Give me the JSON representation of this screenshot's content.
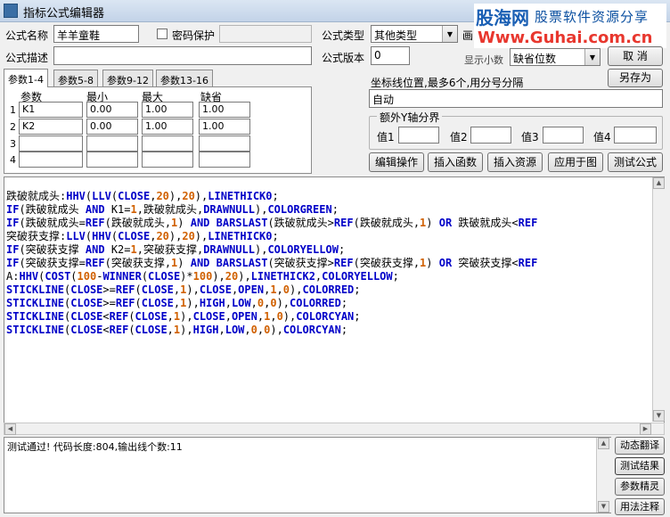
{
  "window": {
    "title": "指标公式编辑器"
  },
  "watermark": {
    "brand": "股海网",
    "tagline": "股票软件资源分享",
    "url": "Www.Guhai.com.cn"
  },
  "form": {
    "name_label": "公式名称",
    "name_value": "羊羊童鞋",
    "password_label": "密码保护",
    "password_checked": false,
    "type_label": "公式类型",
    "type_value": "其他类型",
    "draw_label": "画",
    "desc_label": "公式描述",
    "desc_value": "",
    "version_label": "公式版本",
    "version_value": "0",
    "decimal_label": "显示小数",
    "decimal_value": "缺省位数"
  },
  "buttons": {
    "cancel": "取 消",
    "save_as": "另存为",
    "edit_op": "编辑操作",
    "insert_func": "插入函数",
    "insert_res": "插入资源",
    "apply_chart": "应用于图",
    "test_formula": "测试公式",
    "dyn_translate": "动态翻译",
    "test_result": "测试结果",
    "param_tips": "参数精灵",
    "usage_notes": "用法注释"
  },
  "tabs": [
    "参数1-4",
    "参数5-8",
    "参数9-12",
    "参数13-16"
  ],
  "params": {
    "headers": [
      "参数",
      "最小",
      "最大",
      "缺省"
    ],
    "rows": [
      {
        "num": "1",
        "name": "K1",
        "min": "0.00",
        "max": "1.00",
        "default": "1.00"
      },
      {
        "num": "2",
        "name": "K2",
        "min": "0.00",
        "max": "1.00",
        "default": "1.00"
      },
      {
        "num": "3",
        "name": "",
        "min": "",
        "max": "",
        "default": ""
      },
      {
        "num": "4",
        "name": "",
        "min": "",
        "max": "",
        "default": ""
      }
    ]
  },
  "axis": {
    "label": "坐标线位置,最多6个,用分号分隔",
    "value": "自动",
    "extra_title": "额外Y轴分界",
    "extra_labels": [
      "值1",
      "值2",
      "值3",
      "值4"
    ],
    "extra_values": [
      "",
      "",
      "",
      ""
    ]
  },
  "code_lines": [
    "跌破就成头:HHV(LLV(CLOSE,20),20),LINETHICK0;",
    "IF(跌破就成头 AND K1=1,跌破就成头,DRAWNULL),COLORGREEN;",
    "IF(跌破就成头=REF(跌破就成头,1) AND BARSLAST(跌破就成头>REF(跌破就成头,1) OR 跌破就成头<REF",
    "突破获支撑:LLV(HHV(CLOSE,20),20),LINETHICK0;",
    "IF(突破获支撑 AND K2=1,突破获支撑,DRAWNULL),COLORYELLOW;",
    "IF(突破获支撑=REF(突破获支撑,1) AND BARSLAST(突破获支撑>REF(突破获支撑,1) OR 突破获支撑<REF",
    "A:HHV(COST(100-WINNER(CLOSE)*100),20),LINETHICK2,COLORYELLOW;",
    "STICKLINE(CLOSE>=REF(CLOSE,1),CLOSE,OPEN,1,0),COLORRED;",
    "STICKLINE(CLOSE>=REF(CLOSE,1),HIGH,LOW,0,0),COLORRED;",
    "STICKLINE(CLOSE<REF(CLOSE,1),CLOSE,OPEN,1,0),COLORCYAN;",
    "STICKLINE(CLOSE<REF(CLOSE,1),HIGH,LOW,0,0),COLORCYAN;"
  ],
  "output": {
    "text": "测试通过! 代码长度:804,输出线个数:11"
  },
  "colors": {
    "function": "#0000c8",
    "number": "#d06000",
    "brand": "#1a5fb4",
    "url": "#e8372e"
  }
}
